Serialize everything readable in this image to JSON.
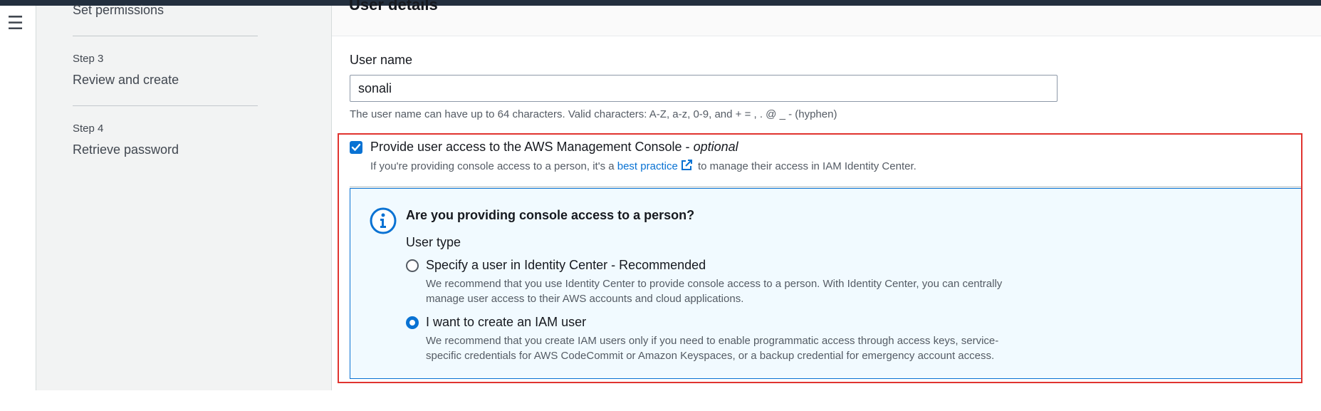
{
  "sidebar": {
    "steps": [
      {
        "label": "",
        "title": "Set permissions"
      },
      {
        "label": "Step 3",
        "title": "Review and create"
      },
      {
        "label": "Step 4",
        "title": "Retrieve password"
      }
    ]
  },
  "main": {
    "section_header": "User details",
    "username": {
      "label": "User name",
      "value": "sonali",
      "constraint": "The user name can have up to 64 characters. Valid characters: A-Z, a-z, 0-9, and + = , . @ _ - (hyphen)"
    },
    "console_access": {
      "checked": true,
      "label": "Provide user access to the AWS Management Console - ",
      "label_optional": "optional",
      "desc_before": "If you're providing console access to a person, it's a ",
      "desc_link": "best practice",
      "desc_after": " to manage their access in IAM Identity Center."
    },
    "info": {
      "title": "Are you providing console access to a person?",
      "user_type_label": "User type",
      "options": [
        {
          "label": "Specify a user in Identity Center - Recommended",
          "selected": false,
          "desc_line1": "We recommend that you use Identity Center to provide console access to a person. With Identity Center, you can centrally",
          "desc_line2": "manage user access to their AWS accounts and cloud applications."
        },
        {
          "label": "I want to create an IAM user",
          "selected": true,
          "desc_line1": "We recommend that you create IAM users only if you need to enable programmatic access through access keys, service-",
          "desc_line2": "specific credentials for AWS CodeCommit or Amazon Keyspaces, or a backup credential for emergency account access."
        }
      ]
    }
  },
  "colors": {
    "accent": "#0972d3",
    "highlight_border": "#e0342f",
    "top_bar": "#232f3e",
    "info_background": "#f1faff"
  },
  "icons": [
    "menu-icon",
    "checkmark-icon",
    "external-link-icon",
    "info-icon"
  ]
}
